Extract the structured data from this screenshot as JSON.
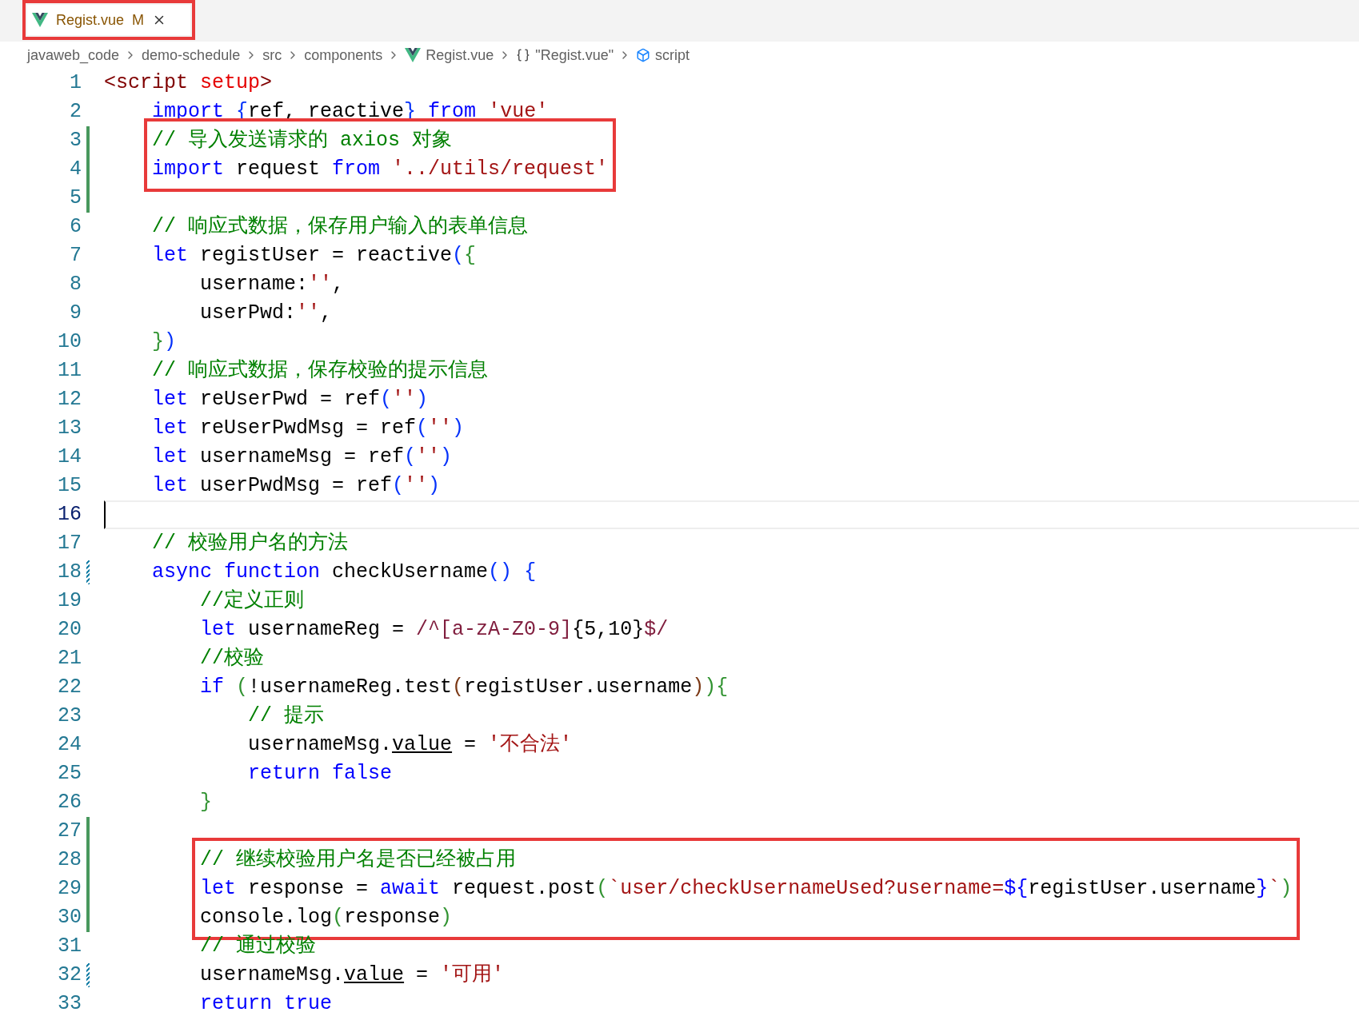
{
  "tab": {
    "label": "Regist.vue",
    "badge": "M",
    "selected": true,
    "boxed": true
  },
  "breadcrumb": [
    {
      "kind": "folder",
      "text": "javaweb_code"
    },
    {
      "kind": "folder",
      "text": "demo-schedule"
    },
    {
      "kind": "folder",
      "text": "src"
    },
    {
      "kind": "folder",
      "text": "components"
    },
    {
      "kind": "vue-file",
      "text": "Regist.vue"
    },
    {
      "kind": "module",
      "text": "\"Regist.vue\""
    },
    {
      "kind": "element",
      "text": "script"
    }
  ],
  "editor": {
    "segments": [
      {
        "boxed": false,
        "lines": [
          {
            "number": "1",
            "kind": "plain",
            "current": false,
            "tokens": [
              {
                "text": "<script",
                "kind": "tag"
              },
              {
                "text": " setup",
                "kind": "attr"
              },
              {
                "text": ">",
                "kind": "tag"
              }
            ]
          },
          {
            "number": "2",
            "kind": "plain",
            "current": false,
            "tokens": [
              {
                "text": "    import",
                "kind": "kw"
              },
              {
                "text": " {",
                "kind": "br1"
              },
              {
                "text": "ref, reactive",
                "kind": "pl"
              },
              {
                "text": "}",
                "kind": "br1"
              },
              {
                "text": " from",
                "kind": "kw"
              },
              {
                "text": " 'vue'",
                "kind": "str"
              }
            ]
          }
        ]
      },
      {
        "boxed": true,
        "lines": [
          {
            "number": "3",
            "kind": "added",
            "current": false,
            "tokens": [
              {
                "text": "    // 导入发送请求的 axios 对象",
                "kind": "cm"
              }
            ]
          },
          {
            "number": "4",
            "kind": "added",
            "current": false,
            "tokens": [
              {
                "text": "    import",
                "kind": "kw"
              },
              {
                "text": " request ",
                "kind": "pl"
              },
              {
                "text": "from",
                "kind": "kw"
              },
              {
                "text": " '../utils/request'",
                "kind": "str"
              }
            ]
          }
        ]
      },
      {
        "boxed": false,
        "lines": [
          {
            "number": "5",
            "kind": "added",
            "current": false
          },
          {
            "number": "6",
            "kind": "plain",
            "current": false,
            "tokens": [
              {
                "text": "    // 响应式数据，保存用户输入的表单信息",
                "kind": "cm"
              }
            ]
          },
          {
            "number": "7",
            "kind": "plain",
            "current": false,
            "tokens": [
              {
                "text": "    let",
                "kind": "kw"
              },
              {
                "text": " registUser = reactive",
                "kind": "pl"
              },
              {
                "text": "(",
                "kind": "br1"
              },
              {
                "text": "{",
                "kind": "br2"
              }
            ]
          },
          {
            "number": "8",
            "kind": "plain",
            "current": false,
            "tokens": [
              {
                "text": "        username:",
                "kind": "pl"
              },
              {
                "text": "''",
                "kind": "str"
              },
              {
                "text": ",",
                "kind": "pl"
              }
            ]
          },
          {
            "number": "9",
            "kind": "plain",
            "current": false,
            "tokens": [
              {
                "text": "        userPwd:",
                "kind": "pl"
              },
              {
                "text": "''",
                "kind": "str"
              },
              {
                "text": ",",
                "kind": "pl"
              }
            ]
          },
          {
            "number": "10",
            "kind": "plain",
            "current": false,
            "tokens": [
              {
                "text": "    }",
                "kind": "br2"
              },
              {
                "text": ")",
                "kind": "br1"
              }
            ]
          },
          {
            "number": "11",
            "kind": "plain",
            "current": false,
            "tokens": [
              {
                "text": "    // 响应式数据，保存校验的提示信息",
                "kind": "cm"
              }
            ]
          },
          {
            "number": "12",
            "kind": "plain",
            "current": false,
            "tokens": [
              {
                "text": "    let",
                "kind": "kw"
              },
              {
                "text": " reUserPwd = ref",
                "kind": "pl"
              },
              {
                "text": "(",
                "kind": "br1"
              },
              {
                "text": "''",
                "kind": "str"
              },
              {
                "text": ")",
                "kind": "br1"
              }
            ]
          },
          {
            "number": "13",
            "kind": "plain",
            "current": false,
            "tokens": [
              {
                "text": "    let",
                "kind": "kw"
              },
              {
                "text": " reUserPwdMsg = ref",
                "kind": "pl"
              },
              {
                "text": "(",
                "kind": "br1"
              },
              {
                "text": "''",
                "kind": "str"
              },
              {
                "text": ")",
                "kind": "br1"
              }
            ]
          },
          {
            "number": "14",
            "kind": "plain",
            "current": false,
            "tokens": [
              {
                "text": "    let",
                "kind": "kw"
              },
              {
                "text": " usernameMsg = ref",
                "kind": "pl"
              },
              {
                "text": "(",
                "kind": "br1"
              },
              {
                "text": "''",
                "kind": "str"
              },
              {
                "text": ")",
                "kind": "br1"
              }
            ]
          },
          {
            "number": "15",
            "kind": "plain",
            "current": false,
            "tokens": [
              {
                "text": "    let",
                "kind": "kw"
              },
              {
                "text": " userPwdMsg = ref",
                "kind": "pl"
              },
              {
                "text": "(",
                "kind": "br1"
              },
              {
                "text": "''",
                "kind": "str"
              },
              {
                "text": ")",
                "kind": "br1"
              }
            ]
          },
          {
            "number": "16",
            "kind": "plain",
            "current": true
          },
          {
            "number": "17",
            "kind": "plain",
            "current": false,
            "tokens": [
              {
                "text": "    // 校验用户名的方法",
                "kind": "cm"
              }
            ]
          },
          {
            "number": "18",
            "kind": "modified",
            "current": false,
            "tokens": [
              {
                "text": "    async",
                "kind": "kw"
              },
              {
                "text": " function",
                "kind": "kw"
              },
              {
                "text": " checkUsername",
                "kind": "pl"
              },
              {
                "text": "()",
                "kind": "br1"
              },
              {
                "text": " {",
                "kind": "br1"
              }
            ]
          },
          {
            "number": "19",
            "kind": "plain",
            "current": false,
            "tokens": [
              {
                "text": "        //定义正则",
                "kind": "cm"
              }
            ]
          },
          {
            "number": "20",
            "kind": "plain",
            "current": false,
            "tokens": [
              {
                "text": "        let",
                "kind": "kw"
              },
              {
                "text": " usernameReg = ",
                "kind": "pl"
              },
              {
                "text": "/^[a-zA-Z0-9]",
                "kind": "re"
              },
              {
                "text": "{5,10}",
                "kind": "pl"
              },
              {
                "text": "$/",
                "kind": "re"
              }
            ]
          },
          {
            "number": "21",
            "kind": "plain",
            "current": false,
            "tokens": [
              {
                "text": "        //校验",
                "kind": "cm"
              }
            ]
          },
          {
            "number": "22",
            "kind": "plain",
            "current": false,
            "tokens": [
              {
                "text": "        if",
                "kind": "kw"
              },
              {
                "text": " (",
                "kind": "br2"
              },
              {
                "text": "!usernameReg.test",
                "kind": "pl"
              },
              {
                "text": "(",
                "kind": "br3"
              },
              {
                "text": "registUser.username",
                "kind": "pl"
              },
              {
                "text": ")",
                "kind": "br3"
              },
              {
                "text": ")",
                "kind": "br2"
              },
              {
                "text": "{",
                "kind": "br2"
              }
            ]
          },
          {
            "number": "23",
            "kind": "plain",
            "current": false,
            "tokens": [
              {
                "text": "            // 提示",
                "kind": "cm"
              }
            ]
          },
          {
            "number": "24",
            "kind": "plain",
            "current": false,
            "tokens": [
              {
                "text": "            usernameMsg.",
                "kind": "pl"
              },
              {
                "text": "value",
                "kind": "u"
              },
              {
                "text": " = ",
                "kind": "pl"
              },
              {
                "text": "'不合法'",
                "kind": "str"
              }
            ]
          },
          {
            "number": "25",
            "kind": "plain",
            "current": false,
            "tokens": [
              {
                "text": "            return false",
                "kind": "kw"
              }
            ]
          },
          {
            "number": "26",
            "kind": "plain",
            "current": false,
            "tokens": [
              {
                "text": "        }",
                "kind": "br2"
              }
            ]
          },
          {
            "number": "27",
            "kind": "added",
            "current": false
          }
        ]
      },
      {
        "boxed": true,
        "lines": [
          {
            "number": "28",
            "kind": "added",
            "current": false,
            "tokens": [
              {
                "text": "        // 继续校验用户名是否已经被占用",
                "kind": "cm"
              }
            ]
          },
          {
            "number": "29",
            "kind": "added",
            "current": false,
            "tokens": [
              {
                "text": "        let",
                "kind": "kw"
              },
              {
                "text": " response = ",
                "kind": "pl"
              },
              {
                "text": "await",
                "kind": "kw"
              },
              {
                "text": " request.post",
                "kind": "pl"
              },
              {
                "text": "(",
                "kind": "br2"
              },
              {
                "text": "`user/checkUsernameUsed?username=",
                "kind": "str"
              },
              {
                "text": "${",
                "kind": "kw"
              },
              {
                "text": "registUser.username",
                "kind": "pl"
              },
              {
                "text": "}",
                "kind": "kw"
              },
              {
                "text": "`",
                "kind": "str"
              },
              {
                "text": ")",
                "kind": "br2"
              }
            ]
          },
          {
            "number": "30",
            "kind": "added",
            "current": false,
            "tokens": [
              {
                "text": "        console.log",
                "kind": "pl"
              },
              {
                "text": "(",
                "kind": "br2"
              },
              {
                "text": "response",
                "kind": "pl"
              },
              {
                "text": ")",
                "kind": "br2"
              }
            ]
          }
        ]
      },
      {
        "boxed": false,
        "lines": [
          {
            "number": "31",
            "kind": "plain",
            "current": false,
            "tokens": [
              {
                "text": "        // 通过校验",
                "kind": "cm"
              }
            ]
          },
          {
            "number": "32",
            "kind": "modified",
            "current": false,
            "tokens": [
              {
                "text": "        usernameMsg.",
                "kind": "pl"
              },
              {
                "text": "value",
                "kind": "u"
              },
              {
                "text": " = ",
                "kind": "pl"
              },
              {
                "text": "'可用'",
                "kind": "str"
              }
            ]
          },
          {
            "number": "33",
            "kind": "plain",
            "current": false,
            "tokens": [
              {
                "text": "        return true",
                "kind": "kw"
              }
            ]
          }
        ]
      }
    ]
  }
}
